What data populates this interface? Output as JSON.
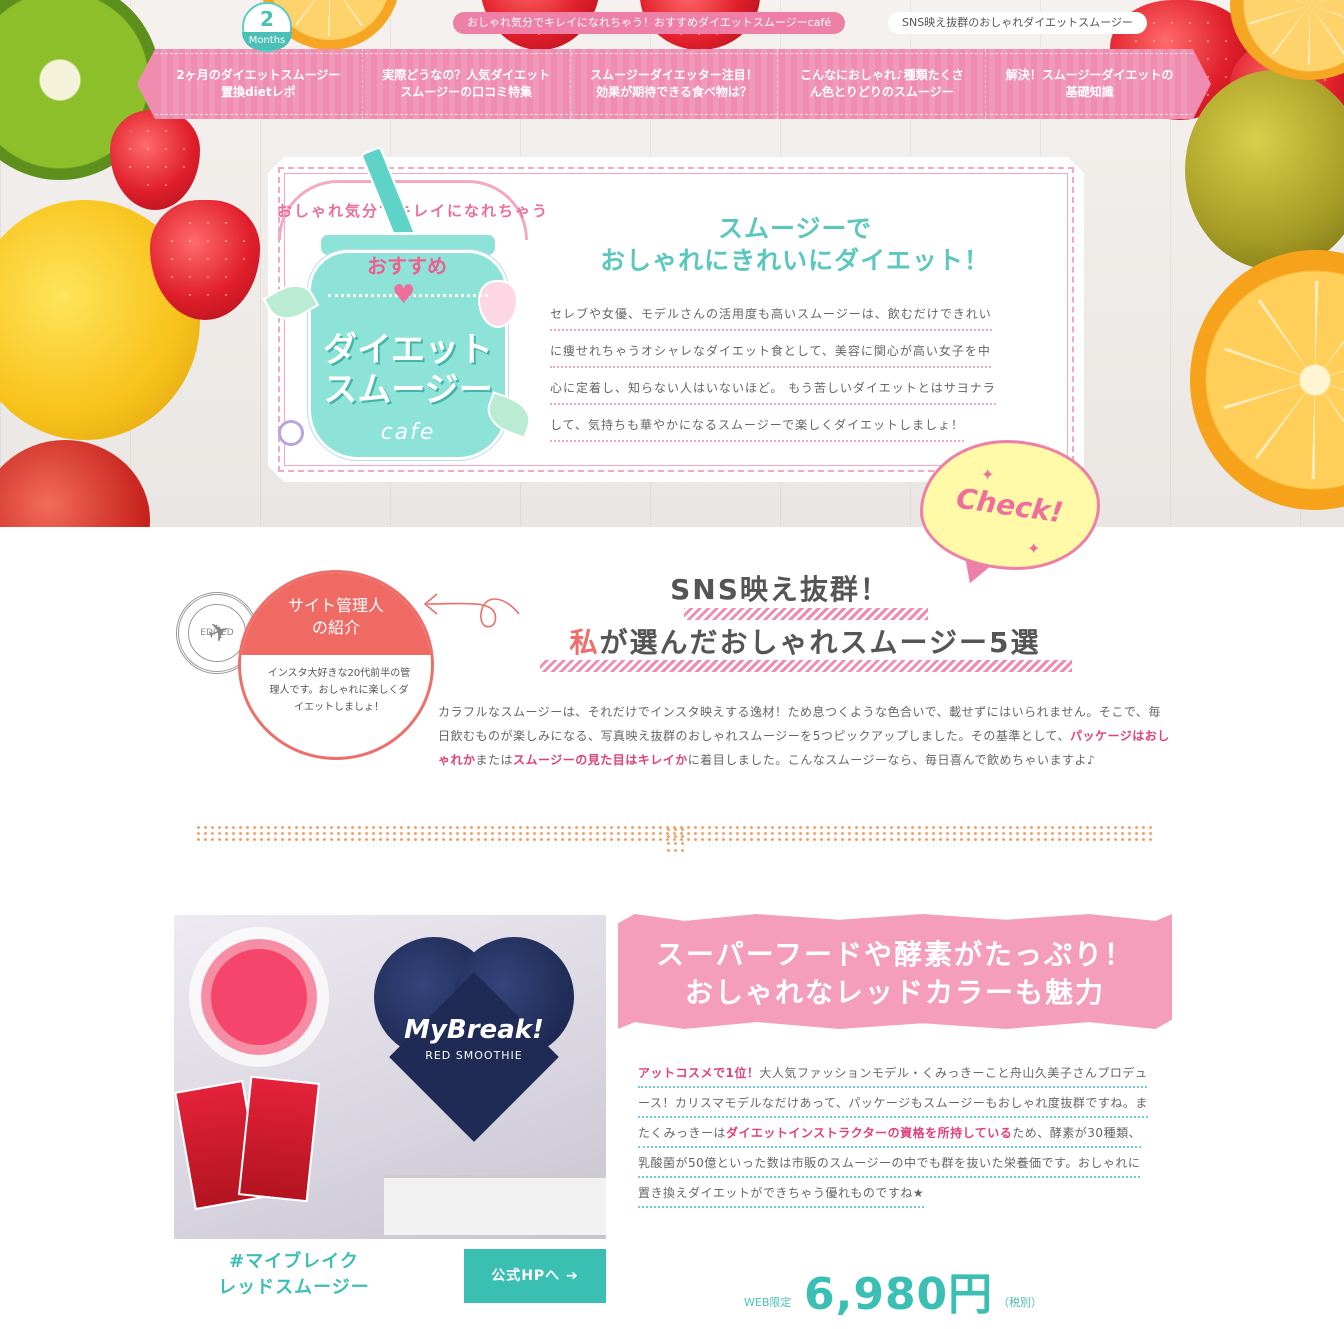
{
  "header": {
    "badge": {
      "number": "2",
      "label": "Months"
    },
    "tags": [
      "おしゃれ気分でキレイになれちゃう！おすすめダイエットスムージーcafé",
      "SNS映え抜群のおしゃれダイエットスムージー"
    ],
    "nav": [
      {
        "line1": "2ヶ月のダイエットスムージー",
        "line2": "置換dietレポ"
      },
      {
        "line1": "実際どうなの？人気ダイエット",
        "line2": "スムージーの口コミ特集"
      },
      {
        "line1": "スムージーダイエッター注目！",
        "line2": "効果が期待できる食べ物は？"
      },
      {
        "line1": "こんなにおしゃれ♪種類たくさ",
        "line2": "ん色とりどりのスムージー"
      },
      {
        "line1": "解決！スムージーダイエットの",
        "line2": "基礎知識"
      }
    ]
  },
  "logo": {
    "arc": "おしゃれ気分でキレイになれちゃう",
    "recommend": "おすすめ",
    "title_line1": "ダイエット",
    "title_line2": "スムージー",
    "cafe": "cafe"
  },
  "hero": {
    "title_line1": "スムージーで",
    "title_line2": "おしゃれにきれいにダイエット！",
    "text_lines": [
      "セレブや女優、モデルさんの活用度も高いスムージーは、飲むだけできれい",
      "に痩せれちゃうオシャレなダイエット食として、美容に関心が高い女子を中",
      "心に定着し、知らない人はいないほど。 もう苦しいダイエットとはサヨナラ",
      "して、気持ちも華やかになるスムージーで楽しくダイエットしましょ！"
    ],
    "check_label": "Check!"
  },
  "admin": {
    "title_line1": "サイト管理人",
    "title_line2": "の紹介",
    "text": "インスタ大好きな20代前半の管理人です。おしゃれに楽しくダイエットしましょ！",
    "stamp": "EDITED"
  },
  "section": {
    "title_line1": "SNS映え抜群！",
    "title_line2_highlight": "私",
    "title_line2_rest": "が選んだおしゃれスムージー5選",
    "intro_1": "カラフルなスムージーは、それだけでインスタ映えする逸材！ため息つくような色合いで、載せずにはいられません。そこで、毎日飲むものが楽しみになる、写真映え抜群のおしゃれスムージーを5つピックアップしました。その基準として、",
    "intro_b1": "パッケージはおしゃれか",
    "intro_2": "または",
    "intro_b2": "スムージーの見た目はキレイか",
    "intro_3": "に着目しました。こんなスムージーなら、毎日喜んで飲めちゃいますよ♪"
  },
  "product": {
    "image": {
      "brand": "MyBreak!",
      "sub": "RED SMOOTHIE"
    },
    "name_line1": "#マイブレイク",
    "name_line2": "レッドスムージー",
    "button": "公式HPへ ➔",
    "ribbon_line1": "スーパーフードや酵素がたっぷり！",
    "ribbon_line2": "おしゃれなレッドカラーも魅力",
    "desc_b1": "アットコスメで1位！",
    "desc_1": "大人気ファッションモデル・くみっきーこと舟山久美子さんプロデュース！カリスマモデルなだけあって、パッケージもスムージーもおしゃれ度抜群ですね。またくみっきーは",
    "desc_b2": "ダイエットインストラクターの資格を所持している",
    "desc_2": "ため、酵素が30種類、乳酸菌が50億といった数は市販のスムージーの中でも群を抜いた栄養価です。おしゃれに置き換えダイエットができちゃう優れものですね★",
    "price_prefix": "WEB限定",
    "price": "6,980円",
    "price_suffix": "（税別）"
  },
  "colors": {
    "pink": "#ef8cb0",
    "teal": "#3cbfb3",
    "coral": "#f06a64",
    "accent_red": "#e0417b"
  }
}
